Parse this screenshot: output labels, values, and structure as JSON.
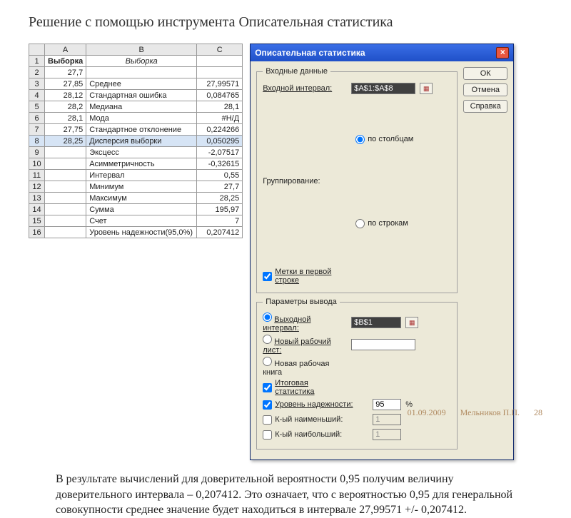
{
  "title": "Решение с помощью инструмента Описательная статистика",
  "sheet": {
    "cols": [
      "A",
      "B",
      "C"
    ],
    "rows": [
      {
        "n": "1",
        "a": "Выборка",
        "b": "Выборка",
        "c": "",
        "hdr": true
      },
      {
        "n": "2",
        "a": "27,7",
        "b": "",
        "c": ""
      },
      {
        "n": "3",
        "a": "27,85",
        "b": "Среднее",
        "c": "27,99571"
      },
      {
        "n": "4",
        "a": "28,12",
        "b": "Стандартная ошибка",
        "c": "0,084765"
      },
      {
        "n": "5",
        "a": "28,2",
        "b": "Медиана",
        "c": "28,1"
      },
      {
        "n": "6",
        "a": "28,1",
        "b": "Мода",
        "c": "#Н/Д"
      },
      {
        "n": "7",
        "a": "27,75",
        "b": "Стандартное отклонение",
        "c": "0,224266"
      },
      {
        "n": "8",
        "a": "28,25",
        "b": "Дисперсия выборки",
        "c": "0,050295",
        "sel": true
      },
      {
        "n": "9",
        "a": "",
        "b": "Эксцесс",
        "c": "-2,07517"
      },
      {
        "n": "10",
        "a": "",
        "b": "Асимметричность",
        "c": "-0,32615"
      },
      {
        "n": "11",
        "a": "",
        "b": "Интервал",
        "c": "0,55"
      },
      {
        "n": "12",
        "a": "",
        "b": "Минимум",
        "c": "27,7"
      },
      {
        "n": "13",
        "a": "",
        "b": "Максимум",
        "c": "28,25"
      },
      {
        "n": "14",
        "a": "",
        "b": "Сумма",
        "c": "195,97"
      },
      {
        "n": "15",
        "a": "",
        "b": "Счет",
        "c": "7"
      },
      {
        "n": "16",
        "a": "",
        "b": "Уровень надежности(95,0%)",
        "c": "0,207412"
      }
    ]
  },
  "dialog": {
    "title": "Описательная статистика",
    "buttons": {
      "ok": "ОК",
      "cancel": "Отмена",
      "help": "Справка"
    },
    "g1": {
      "legend": "Входные данные",
      "inputRangeLabel": "Входной интервал:",
      "inputRangeValue": "$A$1:$A$8",
      "groupLabel": "Группирование:",
      "byCols": "по столбцам",
      "byRows": "по строкам",
      "labelsFirst": "Метки в первой строке"
    },
    "g2": {
      "legend": "Параметры вывода",
      "outRange": "Выходной интервал:",
      "outRangeValue": "$B$1",
      "newSheet": "Новый рабочий лист:",
      "newBook": "Новая рабочая книга",
      "summary": "Итоговая статистика",
      "confidence": "Уровень надежности:",
      "confidenceValue": "95",
      "percent": "%",
      "kSmall": "К-ый наименьший:",
      "kLarge": "К-ый наибольший:",
      "kValue": "1"
    }
  },
  "bodytext": "В результате вычислений для доверительной вероятности 0,95 получим величину доверительного интервала – 0,207412. Это означает, что с вероятностью 0,95 для генеральной совокупности среднее значение будет находиться в интервале 27,99571 +/- 0,207412.",
  "footer": {
    "date": "01.09.2009",
    "author": "Мельников П.П.",
    "page": "28"
  }
}
